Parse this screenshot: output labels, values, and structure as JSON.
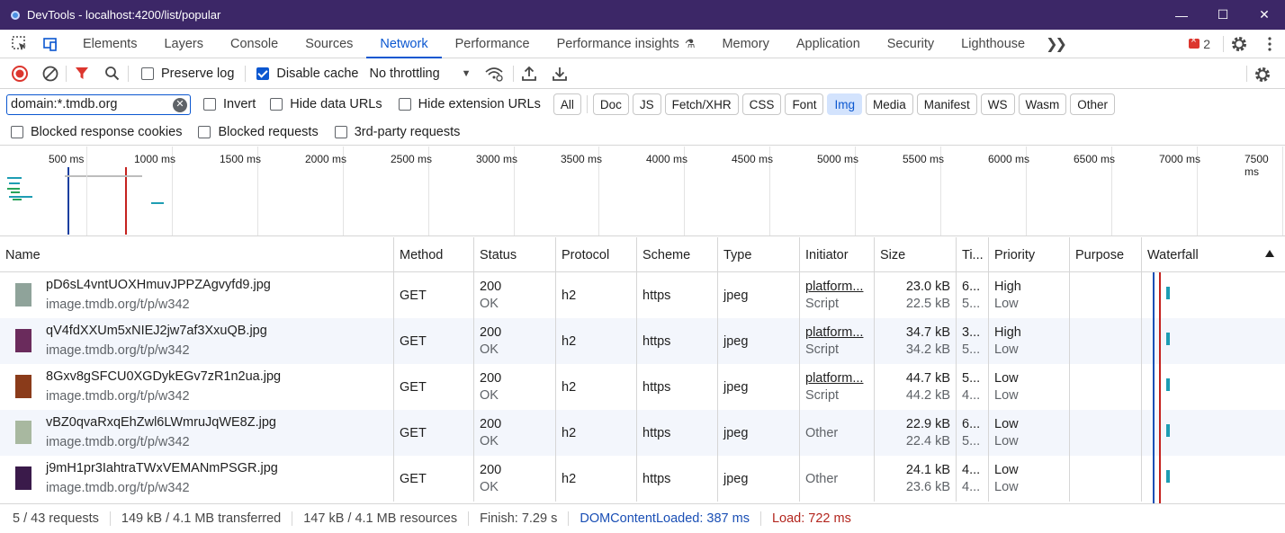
{
  "window": {
    "title": "DevTools - localhost:4200/list/popular",
    "minimize": "—",
    "maximize": "☐",
    "close": "✕"
  },
  "tabs": [
    {
      "label": "Elements"
    },
    {
      "label": "Layers"
    },
    {
      "label": "Console"
    },
    {
      "label": "Sources"
    },
    {
      "label": "Network",
      "active": true
    },
    {
      "label": "Performance"
    },
    {
      "label": "Performance insights"
    },
    {
      "label": "Memory"
    },
    {
      "label": "Application"
    },
    {
      "label": "Security"
    },
    {
      "label": "Lighthouse"
    }
  ],
  "issues_count": "2",
  "toolbar": {
    "preserve_log": "Preserve log",
    "disable_cache": "Disable cache",
    "throttling": "No throttling"
  },
  "filter": {
    "value": "domain:*.tmdb.org",
    "invert": "Invert",
    "hide_data_urls": "Hide data URLs",
    "hide_extension_urls": "Hide extension URLs",
    "types": [
      "All",
      "Doc",
      "JS",
      "Fetch/XHR",
      "CSS",
      "Font",
      "Img",
      "Media",
      "Manifest",
      "WS",
      "Wasm",
      "Other"
    ],
    "active_type": "Img",
    "blocked_cookies": "Blocked response cookies",
    "blocked_requests": "Blocked requests",
    "third_party": "3rd-party requests"
  },
  "overview": {
    "ticks": [
      "500 ms",
      "1000 ms",
      "1500 ms",
      "2000 ms",
      "2500 ms",
      "3000 ms",
      "3500 ms",
      "4000 ms",
      "4500 ms",
      "5000 ms",
      "5500 ms",
      "6000 ms",
      "6500 ms",
      "7000 ms",
      "7500 ms"
    ]
  },
  "table": {
    "columns": [
      "Name",
      "Method",
      "Status",
      "Protocol",
      "Scheme",
      "Type",
      "Initiator",
      "Size",
      "Ti...",
      "Priority",
      "Purpose",
      "Waterfall"
    ],
    "rows": [
      {
        "name": "pD6sL4vntUOXHmuvJPPZAgvyfd9.jpg",
        "host": "image.tmdb.org/t/p/w342",
        "method": "GET",
        "status": "200",
        "status_text": "OK",
        "protocol": "h2",
        "scheme": "https",
        "type": "jpeg",
        "initiator": "platform...",
        "initiator_sub": "Script",
        "size": "23.0 kB",
        "size_sub": "22.5 kB",
        "time": "6...",
        "time_sub": "5...",
        "priority": "High",
        "priority_sub": "Low",
        "thumb_color": "#8fa39a"
      },
      {
        "name": "qV4fdXXUm5xNIEJ2jw7af3XxuQB.jpg",
        "host": "image.tmdb.org/t/p/w342",
        "method": "GET",
        "status": "200",
        "status_text": "OK",
        "protocol": "h2",
        "scheme": "https",
        "type": "jpeg",
        "initiator": "platform...",
        "initiator_sub": "Script",
        "size": "34.7 kB",
        "size_sub": "34.2 kB",
        "time": "3...",
        "time_sub": "5...",
        "priority": "High",
        "priority_sub": "Low",
        "thumb_color": "#6a2b5c"
      },
      {
        "name": "8Gxv8gSFCU0XGDykEGv7zR1n2ua.jpg",
        "host": "image.tmdb.org/t/p/w342",
        "method": "GET",
        "status": "200",
        "status_text": "OK",
        "protocol": "h2",
        "scheme": "https",
        "type": "jpeg",
        "initiator": "platform...",
        "initiator_sub": "Script",
        "size": "44.7 kB",
        "size_sub": "44.2 kB",
        "time": "5...",
        "time_sub": "4...",
        "priority": "Low",
        "priority_sub": "Low",
        "thumb_color": "#8a3b1a"
      },
      {
        "name": "vBZ0qvaRxqEhZwl6LWmruJqWE8Z.jpg",
        "host": "image.tmdb.org/t/p/w342",
        "method": "GET",
        "status": "200",
        "status_text": "OK",
        "protocol": "h2",
        "scheme": "https",
        "type": "jpeg",
        "initiator": "Other",
        "initiator_sub": "",
        "size": "22.9 kB",
        "size_sub": "22.4 kB",
        "time": "6...",
        "time_sub": "5...",
        "priority": "Low",
        "priority_sub": "Low",
        "thumb_color": "#a8b8a0"
      },
      {
        "name": "j9mH1pr3IahtraTWxVEMANmPSGR.jpg",
        "host": "image.tmdb.org/t/p/w342",
        "method": "GET",
        "status": "200",
        "status_text": "OK",
        "protocol": "h2",
        "scheme": "https",
        "type": "jpeg",
        "initiator": "Other",
        "initiator_sub": "",
        "size": "24.1 kB",
        "size_sub": "23.6 kB",
        "time": "4...",
        "time_sub": "4...",
        "priority": "Low",
        "priority_sub": "Low",
        "thumb_color": "#3a1a4a"
      }
    ]
  },
  "status_bar": {
    "requests": "5 / 43 requests",
    "transferred": "149 kB / 4.1 MB transferred",
    "resources": "147 kB / 4.1 MB resources",
    "finish": "Finish: 7.29 s",
    "dom": "DOMContentLoaded: 387 ms",
    "load": "Load: 722 ms"
  },
  "colors": {
    "titlebar": "#3c2767",
    "accent": "#0b57d0",
    "dom_line": "#1a4fb5",
    "load_line": "#c5221f",
    "waterfall_bar": "#1e9db3"
  }
}
